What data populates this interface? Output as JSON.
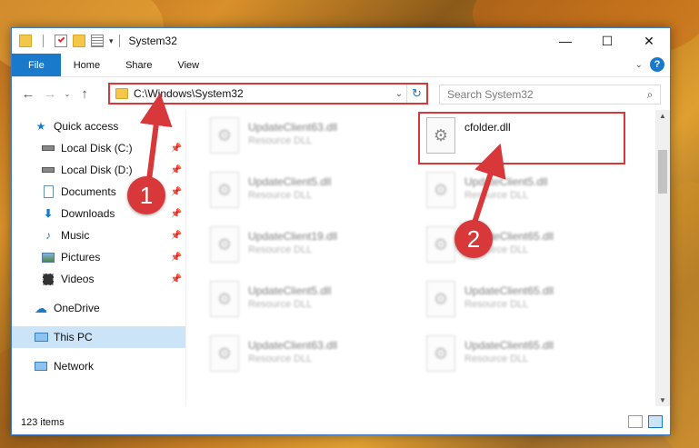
{
  "window": {
    "title": "System32",
    "controls": {
      "minimize": "—",
      "maximize": "☐",
      "close": "✕"
    }
  },
  "ribbon": {
    "tabs": [
      "File",
      "Home",
      "Share",
      "View"
    ],
    "help": "?"
  },
  "address_bar": {
    "path": "C:\\Windows\\System32"
  },
  "search": {
    "placeholder": "Search System32"
  },
  "sidebar": {
    "quick_access": "Quick access",
    "items": [
      {
        "label": "Local Disk (C:)",
        "icon": "drive-icon"
      },
      {
        "label": "Local Disk (D:)",
        "icon": "drive-icon"
      },
      {
        "label": "Documents",
        "icon": "documents-icon"
      },
      {
        "label": "Downloads",
        "icon": "downloads-icon"
      },
      {
        "label": "Music",
        "icon": "music-icon"
      },
      {
        "label": "Pictures",
        "icon": "pictures-icon"
      },
      {
        "label": "Videos",
        "icon": "videos-icon"
      }
    ],
    "onedrive": "OneDrive",
    "this_pc": "This PC",
    "network": "Network"
  },
  "files": {
    "left_column": [
      {
        "name": "UpdateClient63.dll",
        "type": "Resource DLL"
      },
      {
        "name": "UpdateClient5.dll",
        "type": "Resource DLL"
      },
      {
        "name": "UpdateClient19.dll",
        "type": "Resource DLL"
      },
      {
        "name": "UpdateClient5.dll",
        "type": "Resource DLL"
      },
      {
        "name": "UpdateClient63.dll",
        "type": "Resource DLL"
      }
    ],
    "right_column": [
      {
        "name": "cfolder.dll",
        "type": ""
      },
      {
        "name": "UpdateClient5.dll",
        "type": "Resource DLL"
      },
      {
        "name": "UpdateClient65.dll",
        "type": "Resource DLL"
      },
      {
        "name": "UpdateClient65.dll",
        "type": "Resource DLL"
      },
      {
        "name": "UpdateClient65.dll",
        "type": "Resource DLL"
      }
    ]
  },
  "status": {
    "item_count": "123 items"
  },
  "annotations": {
    "step1": "1",
    "step2": "2",
    "accent": "#d9383a"
  }
}
